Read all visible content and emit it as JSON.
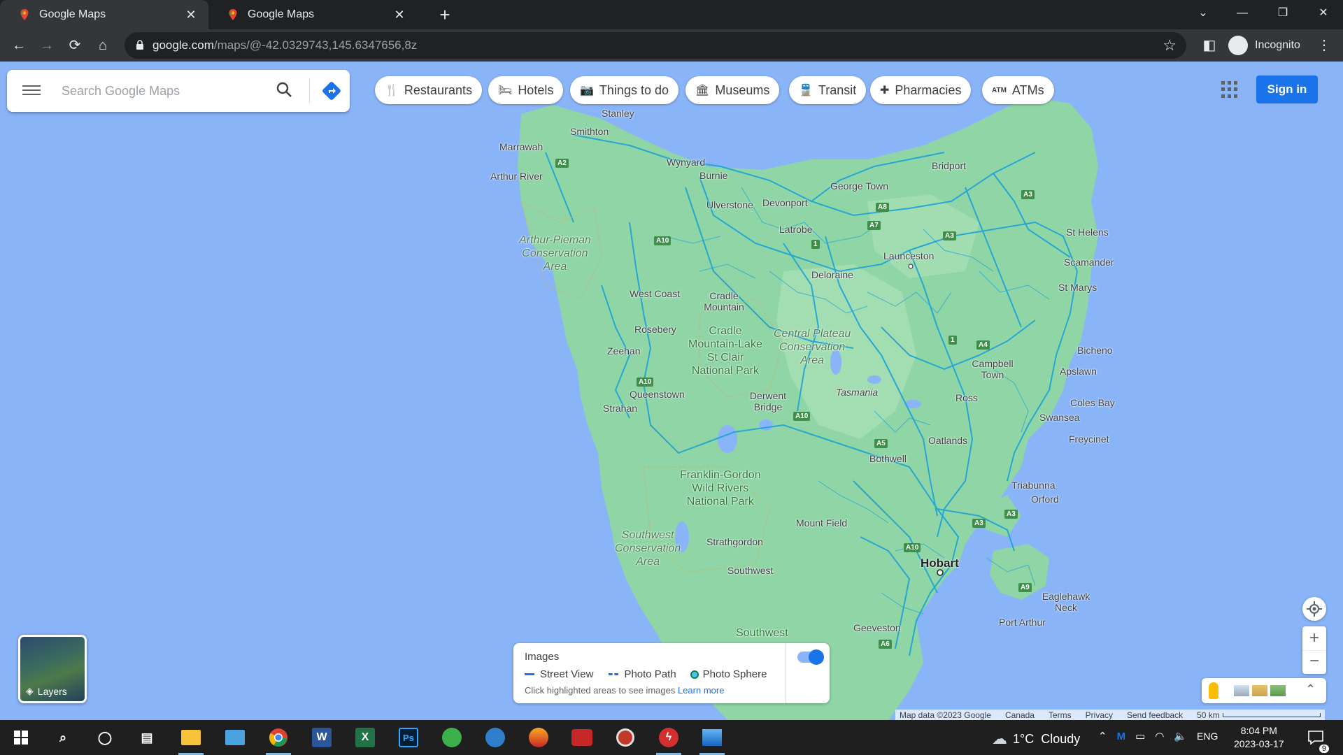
{
  "browser": {
    "tabs": [
      {
        "label": "Google Maps",
        "active": true
      },
      {
        "label": "Google Maps",
        "active": false
      }
    ],
    "url_host": "google.com",
    "url_path": "/maps/@-42.0329743,145.6347656,8z",
    "profile_label": "Incognito"
  },
  "maps": {
    "search_placeholder": "Search Google Maps",
    "chips": [
      {
        "label": "Restaurants",
        "icon": "fork-knife-icon"
      },
      {
        "label": "Hotels",
        "icon": "bed-icon"
      },
      {
        "label": "Things to do",
        "icon": "camera-icon"
      },
      {
        "label": "Museums",
        "icon": "museum-icon"
      },
      {
        "label": "Transit",
        "icon": "train-icon"
      },
      {
        "label": "Pharmacies",
        "icon": "pharmacy-icon"
      },
      {
        "label": "ATMs",
        "icon": "atm-icon"
      }
    ],
    "sign_in": "Sign in",
    "layers_label": "Layers",
    "images_panel": {
      "title": "Images",
      "street_view": "Street View",
      "photo_path": "Photo Path",
      "photo_sphere": "Photo Sphere",
      "hint": "Click highlighted areas to see images",
      "learn_more": "Learn more"
    },
    "footer": {
      "map_data": "Map data ©2023 Google",
      "country": "Canada",
      "terms": "Terms",
      "privacy": "Privacy",
      "feedback": "Send feedback",
      "scale": "50 km"
    },
    "places": [
      "Stanley",
      "Smithton",
      "Marrawah",
      "Arthur River",
      "Wynyard",
      "Burnie",
      "Ulverstone",
      "Devonport",
      "Latrobe",
      "George Town",
      "Bridport",
      "Launceston",
      "Deloraine",
      "St Helens",
      "Scamander",
      "St Marys",
      "West Coast",
      "Cradle Mountain",
      "Rosebery",
      "Zeehan",
      "Queenstown",
      "Strahan",
      "Derwent Bridge",
      "Tasmania",
      "Campbell Town",
      "Ross",
      "Bicheno",
      "Apslawn",
      "Coles Bay",
      "Swansea",
      "Freycinet",
      "Oatlands",
      "Bothwell",
      "Triabunna",
      "Orford",
      "Mount Field",
      "Strathgordon",
      "Southwest",
      "Hobart",
      "Eaglehawk Neck",
      "Port Arthur",
      "Geeveston"
    ],
    "parks": [
      "Arthur-Pieman\nConservation\nArea",
      "Cradle\nMountain-Lake\nSt Clair\nNational Park",
      "Central Plateau\nConservation\nArea",
      "Franklin-Gordon\nWild Rivers\nNational Park",
      "Southwest\nConservation\nArea",
      "Southwest"
    ],
    "shields": [
      "A2",
      "A10",
      "A8",
      "A7",
      "A3",
      "1",
      "A4",
      "A10",
      "A10",
      "A5",
      "A3",
      "A3",
      "A10",
      "A9",
      "A6",
      "1",
      "A3"
    ]
  },
  "taskbar": {
    "weather": "1°C  Cloudy",
    "lang": "ENG",
    "time": "8:04 PM",
    "date": "2023-03-17",
    "notifications": "9"
  },
  "colors": {
    "water": "#8ab4f8",
    "land": "#8fd5a6",
    "roads": "#1aa3d6",
    "accent": "#1a73e8"
  }
}
